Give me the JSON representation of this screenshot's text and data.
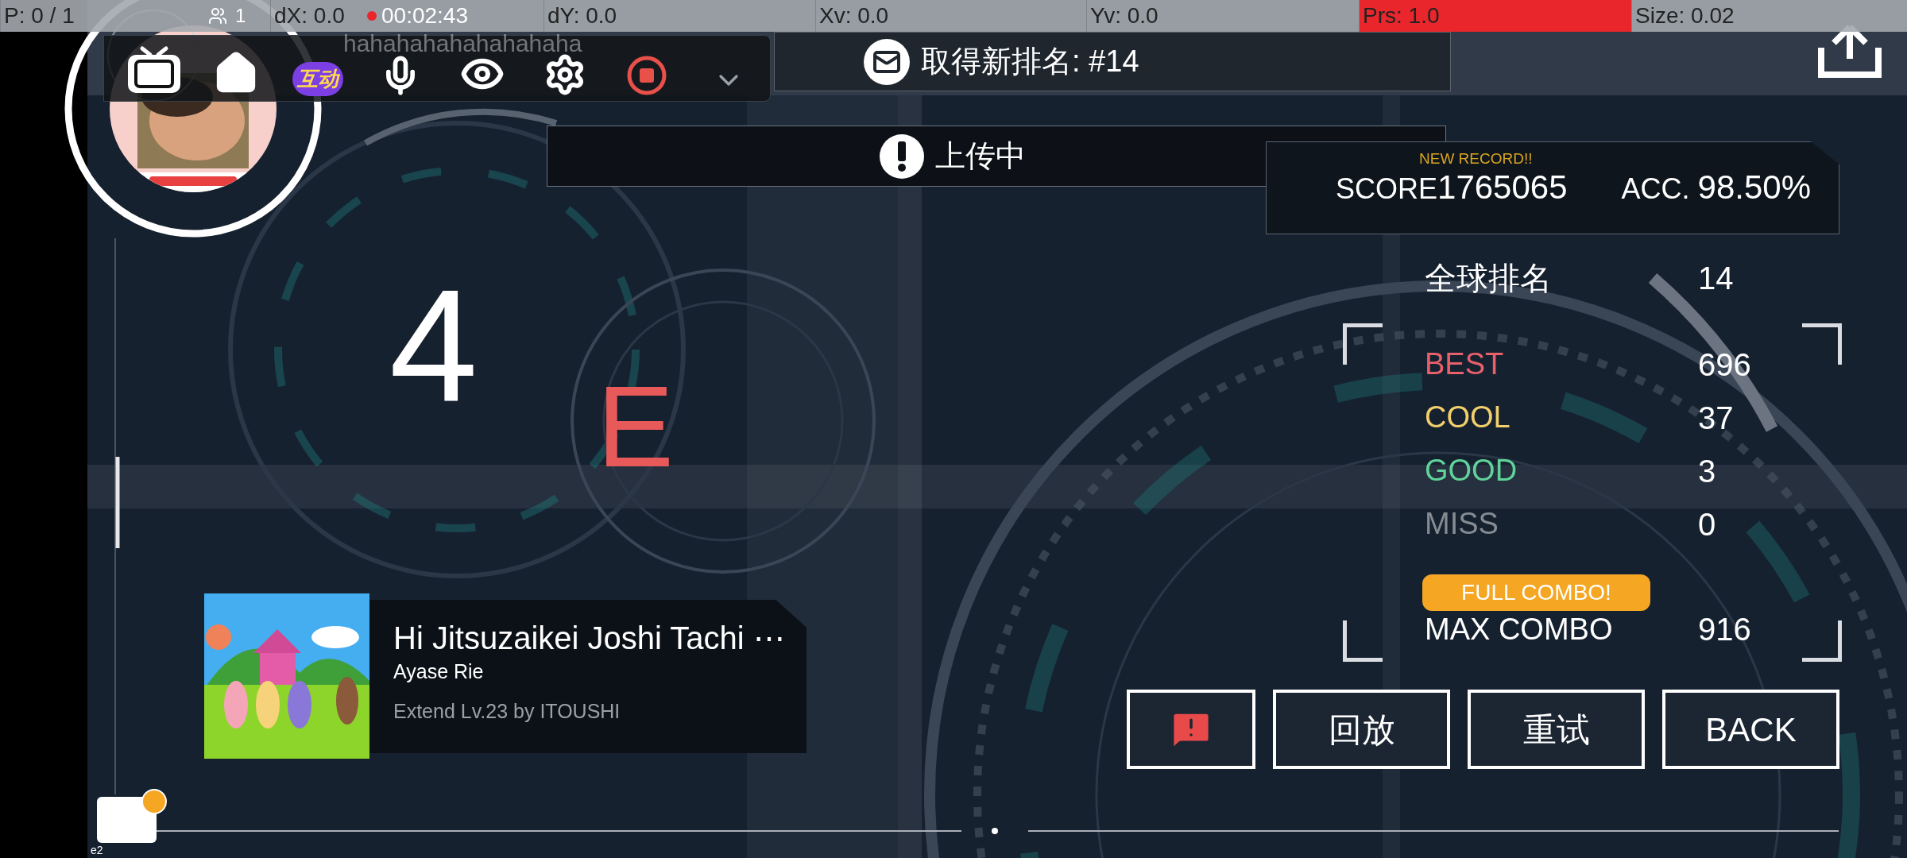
{
  "debug_bar": [
    {
      "text": "P: 0 / 1",
      "highlighted": false
    },
    {
      "text": "dX: 0.0",
      "highlighted": false
    },
    {
      "text": "dY: 0.0",
      "highlighted": false
    },
    {
      "text": "Xv: 0.0",
      "highlighted": false
    },
    {
      "text": "Yv: 0.0",
      "highlighted": false
    },
    {
      "text": "Prs: 1.0",
      "highlighted": true
    },
    {
      "text": "Size: 0.02",
      "highlighted": false
    }
  ],
  "recorder": {
    "viewers": "1",
    "timer": "00:02:43",
    "badge": "互动"
  },
  "danmaku": "hahahahahahahahaha",
  "notification": {
    "text": "取得新排名: #14"
  },
  "toast": {
    "text": "上传中"
  },
  "grade": [
    {
      "text": "4",
      "color": "#ffffff"
    },
    {
      "text": "E",
      "color": "#e85a5a"
    }
  ],
  "score": {
    "badge": "NEW RECORD!!",
    "score_label": "SCORE",
    "score": "1765065",
    "acc_label": "ACC.",
    "acc": "98.50%"
  },
  "rank": {
    "label": "全球排名",
    "value": "14"
  },
  "judgements": [
    {
      "label": "BEST",
      "value": "696",
      "color": "#e8606a"
    },
    {
      "label": "COOL",
      "value": "37",
      "color": "#f2cf6b"
    },
    {
      "label": "GOOD",
      "value": "3",
      "color": "#5fd39a"
    },
    {
      "label": "MISS",
      "value": "0",
      "color": "#858b93"
    }
  ],
  "full_combo": "FULL COMBO!",
  "max_combo": {
    "label": "MAX COMBO",
    "value": "916"
  },
  "song": {
    "title": "Hi Jitsuzaikei Joshi Tachi ⋯",
    "artist": "Ayase Rie",
    "chart": "Extend Lv.23 by ITOUSHI"
  },
  "buttons": [
    {
      "kind": "report"
    },
    {
      "kind": "text",
      "label": "回放"
    },
    {
      "kind": "text",
      "label": "重试"
    },
    {
      "kind": "text",
      "label": "BACK"
    }
  ],
  "corner_label": "e2"
}
